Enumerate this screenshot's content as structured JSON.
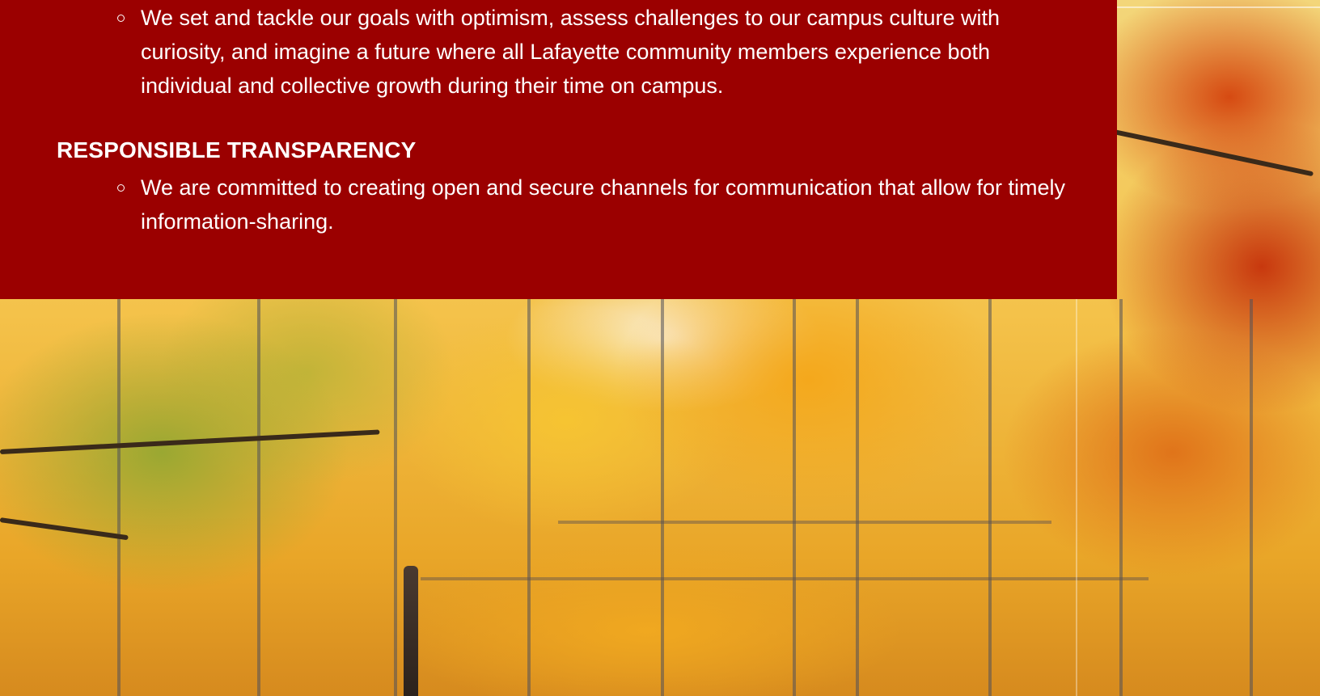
{
  "colors": {
    "panel_background": "#9b0000",
    "panel_text": "#ffffff"
  },
  "content": {
    "previous_value_bullet": "We set and tackle our goals with optimism, assess challenges to our campus culture with curiosity, and imagine a future where all Lafayette community members experience both individual and collective growth during their time on campus.",
    "section_heading": "RESPONSIBLE TRANSPARENCY",
    "section_bullet": "We are committed to creating open and secure channels for communication that allow for timely information-sharing."
  },
  "background_image": {
    "icon": "autumn-campus-photo"
  }
}
